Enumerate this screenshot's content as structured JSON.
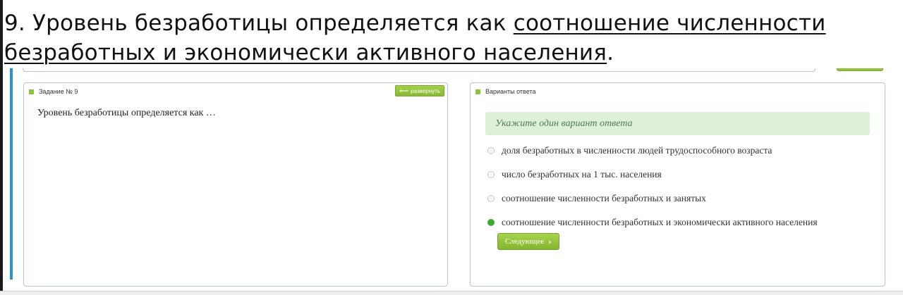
{
  "caption": {
    "prefix": "9. Уровень безработицы определяется как ",
    "answer": "соотношение численности безработных и экономически активного населения",
    "suffix": "."
  },
  "task_panel": {
    "title": "Задание № 9",
    "expand_label": "развернуть",
    "expand_icon": "arrow-left-icon",
    "question": "Уровень безработицы определяется как …"
  },
  "answers_panel": {
    "title": "Варианты ответа",
    "hint": "Укажите один вариант ответа",
    "options": [
      {
        "label": "доля безработных в численности людей трудоспособного возраста",
        "selected": false
      },
      {
        "label": "число безработных на 1 тыс. населения",
        "selected": false
      },
      {
        "label": "соотношение численности безработных и занятых",
        "selected": false
      },
      {
        "label": "соотношение численности безработных и экономически активного населения",
        "selected": true
      }
    ],
    "next_label": "Следующее",
    "next_icon": "chevron-right-icon"
  },
  "colors": {
    "accent_green": "#8ac53b",
    "selected_radio": "#3cab2e",
    "hint_bg": "#dff0d8",
    "panel_border": "#b8c2e0",
    "left_accent": "#2a93c9"
  }
}
